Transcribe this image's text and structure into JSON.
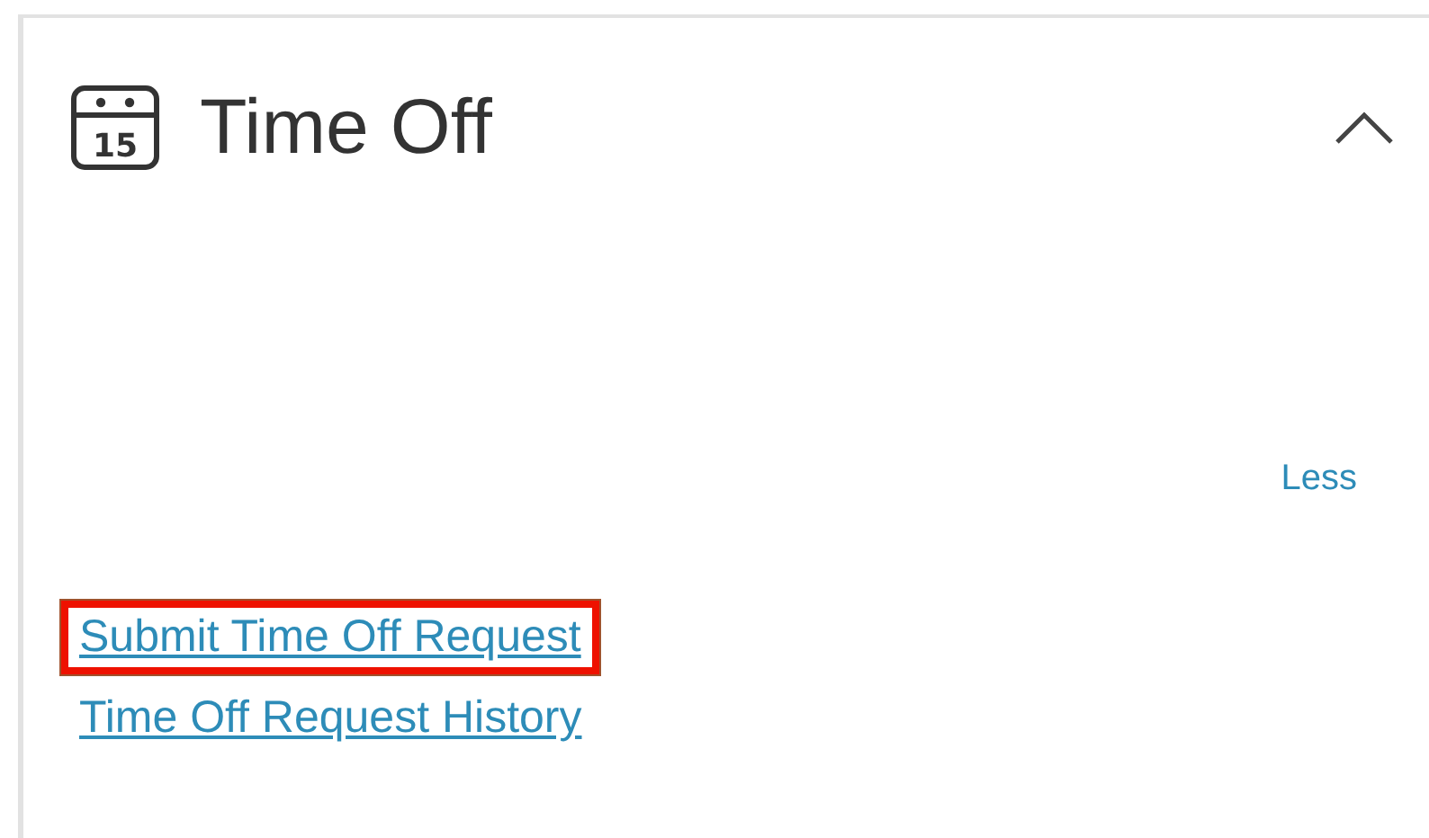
{
  "card": {
    "title": "Time Off",
    "icon_day": "15",
    "expanded": true,
    "toggle_label": "Less",
    "links": [
      {
        "label": "Submit Time Off Request",
        "highlighted": true
      },
      {
        "label": "Time Off Request History",
        "highlighted": false
      }
    ]
  }
}
